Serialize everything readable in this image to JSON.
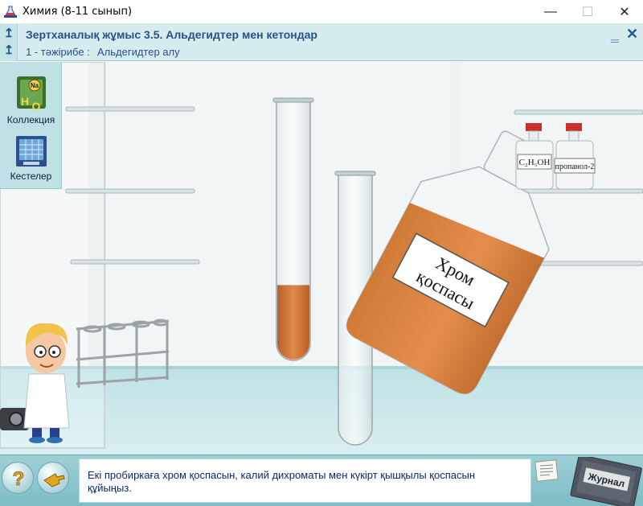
{
  "window": {
    "title": "Химия (8-11 сынып)",
    "min_glyph": "—",
    "max_glyph": "☐",
    "close_glyph": "✕"
  },
  "header": {
    "title": "Зертханалық жұмыс 3.5. Альдегидтер мен кетондар",
    "experiment_number": "1 - тәжірибе :",
    "experiment_name": "Альдегидтер алу",
    "nav_up_glyph": "↥",
    "nav_down_glyph": "↥",
    "min_glyph": "‗",
    "close_glyph": "✕"
  },
  "sidebar": {
    "items": [
      {
        "label": "Коллекция",
        "icon": "collection-icon"
      },
      {
        "label": "Кестелер",
        "icon": "tables-icon"
      }
    ]
  },
  "scene": {
    "bottle_label_line1": "Хром",
    "bottle_label_line2": "қоспасы",
    "reagent1_label": "C₂H₅OH",
    "reagent2_label": "пропанол-2",
    "tube1_fill": 0.29,
    "tube2_fill": 0
  },
  "bottom": {
    "message": "Екі пробиркаға хром қоспасын, калий дихроматы мен күкірт қышқылы қоспасын құйыңыз.",
    "help_glyph": "?",
    "journal_label": "Журнал"
  },
  "colors": {
    "header_bg": "#d6ecef",
    "title_text": "#2a4f8a",
    "liquid": "#d27a3c",
    "bottom_bar": "#8fc7ce"
  }
}
